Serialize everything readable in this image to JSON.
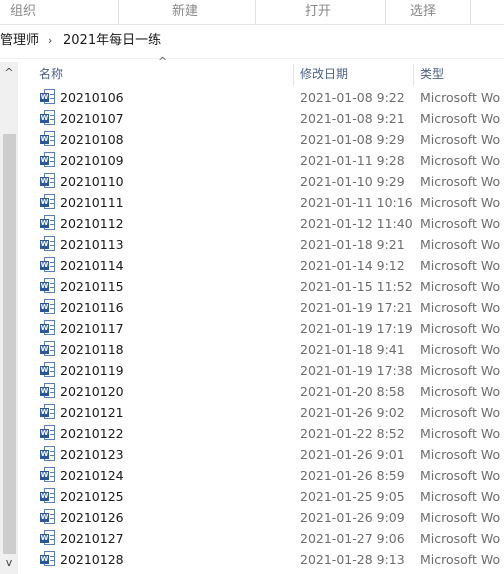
{
  "ribbon": {
    "groups": [
      "组织",
      "新建",
      "打开",
      "选择"
    ]
  },
  "address": {
    "segments": [
      "管理师",
      "2021年每日一练"
    ],
    "separator": "›"
  },
  "columns": {
    "name": "名称",
    "date": "修改日期",
    "type": "类型",
    "sort_indicator": "^"
  },
  "scrollbar": {
    "up": "^",
    "down": "v"
  },
  "files": [
    {
      "name": "20210106",
      "date": "2021-01-08 9:22",
      "type": "Microsoft Wo"
    },
    {
      "name": "20210107",
      "date": "2021-01-08 9:21",
      "type": "Microsoft Wo"
    },
    {
      "name": "20210108",
      "date": "2021-01-08 9:29",
      "type": "Microsoft Wo"
    },
    {
      "name": "20210109",
      "date": "2021-01-11 9:28",
      "type": "Microsoft Wo"
    },
    {
      "name": "20210110",
      "date": "2021-01-10 9:29",
      "type": "Microsoft Wo"
    },
    {
      "name": "20210111",
      "date": "2021-01-11 10:16",
      "type": "Microsoft Wo"
    },
    {
      "name": "20210112",
      "date": "2021-01-12 11:40",
      "type": "Microsoft Wo"
    },
    {
      "name": "20210113",
      "date": "2021-01-18 9:21",
      "type": "Microsoft Wo"
    },
    {
      "name": "20210114",
      "date": "2021-01-14 9:12",
      "type": "Microsoft Wo"
    },
    {
      "name": "20210115",
      "date": "2021-01-15 11:52",
      "type": "Microsoft Wo"
    },
    {
      "name": "20210116",
      "date": "2021-01-19 17:21",
      "type": "Microsoft Wo"
    },
    {
      "name": "20210117",
      "date": "2021-01-19 17:19",
      "type": "Microsoft Wo"
    },
    {
      "name": "20210118",
      "date": "2021-01-18 9:41",
      "type": "Microsoft Wo"
    },
    {
      "name": "20210119",
      "date": "2021-01-19 17:38",
      "type": "Microsoft Wo"
    },
    {
      "name": "20210120",
      "date": "2021-01-20 8:58",
      "type": "Microsoft Wo"
    },
    {
      "name": "20210121",
      "date": "2021-01-26 9:02",
      "type": "Microsoft Wo"
    },
    {
      "name": "20210122",
      "date": "2021-01-22 8:52",
      "type": "Microsoft Wo"
    },
    {
      "name": "20210123",
      "date": "2021-01-26 9:01",
      "type": "Microsoft Wo"
    },
    {
      "name": "20210124",
      "date": "2021-01-26 8:59",
      "type": "Microsoft Wo"
    },
    {
      "name": "20210125",
      "date": "2021-01-25 9:05",
      "type": "Microsoft Wo"
    },
    {
      "name": "20210126",
      "date": "2021-01-26 9:09",
      "type": "Microsoft Wo"
    },
    {
      "name": "20210127",
      "date": "2021-01-27 9:06",
      "type": "Microsoft Wo"
    },
    {
      "name": "20210128",
      "date": "2021-01-28 9:13",
      "type": "Microsoft Wo"
    }
  ],
  "file_icon": "word-document-icon",
  "file_icon_badge": "W"
}
